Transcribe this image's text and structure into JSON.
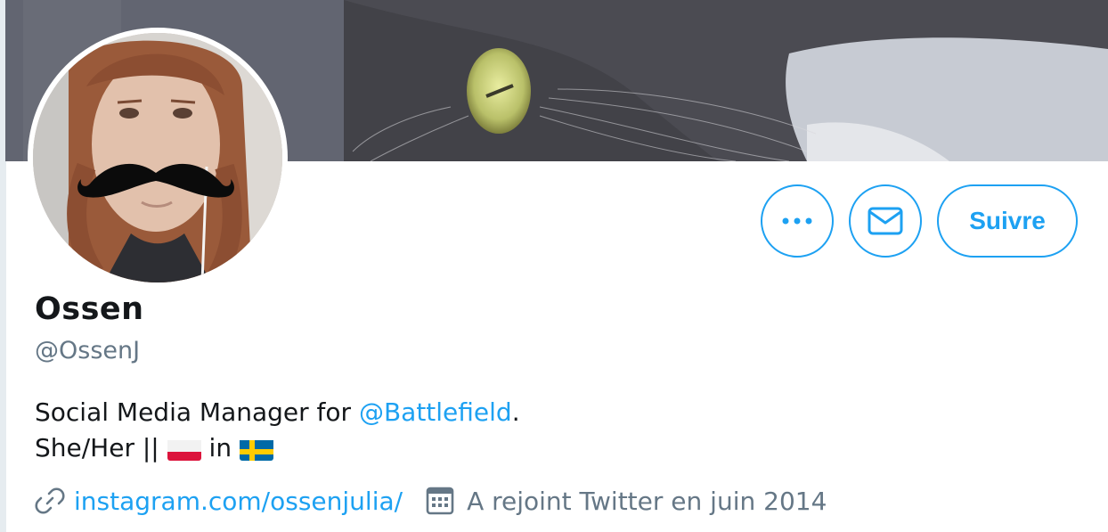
{
  "profile": {
    "name": "Ossen",
    "handle": "@OssenJ",
    "bio": {
      "line1_prefix": "Social Media Manager for ",
      "line1_mention": "@Battlefield",
      "line1_suffix": ".",
      "line2_prefix": "She/Her || ",
      "line2_middle": " in "
    },
    "website": "instagram.com/ossenjulia/",
    "joined": "A rejoint Twitter en juin 2014"
  },
  "actions": {
    "more_icon": "more-dots-icon",
    "message_icon": "envelope-icon",
    "follow_label": "Suivre"
  },
  "flags": [
    "poland-flag-icon",
    "sweden-flag-icon"
  ],
  "colors": {
    "accent": "#1da1f2",
    "text": "#14171a",
    "secondary": "#657786"
  }
}
